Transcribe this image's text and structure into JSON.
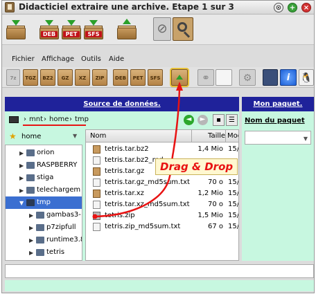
{
  "window": {
    "title": "Didacticiel extraire une archive. Etape 1 sur 3",
    "controls": {
      "minimize": "⊙",
      "maximize": "+",
      "close": "×"
    }
  },
  "toolbar_top": {
    "buttons": [
      {
        "icon": "extract-box-icon",
        "label": ""
      },
      {
        "icon": "deb-package-icon",
        "label": "DEB"
      },
      {
        "icon": "pet-package-icon",
        "label": "PET"
      },
      {
        "icon": "sfs-package-icon",
        "label": "SFS"
      },
      {
        "icon": "install-box-icon",
        "label": ""
      },
      {
        "icon": "paperclip-icon",
        "label": ""
      },
      {
        "icon": "magnifier-icon",
        "label": ""
      }
    ]
  },
  "menu": [
    "Fichier",
    "Affichage",
    "Outils",
    "Aide"
  ],
  "toolbar_formats": [
    "7z",
    "TGZ",
    "BZ2",
    "GZ",
    "XZ",
    "ZIP",
    "DEB",
    "PET",
    "SFS"
  ],
  "panels": {
    "source_title": "Source de données.",
    "package_title": "Mon paquet."
  },
  "path": {
    "crumbs": [
      "mnt",
      "home",
      "tmp"
    ]
  },
  "places": {
    "current": "home"
  },
  "tree": [
    {
      "name": "orion",
      "expanded": false,
      "selected": false
    },
    {
      "name": "RASPBERRY",
      "expanded": false,
      "selected": false
    },
    {
      "name": "stiga",
      "expanded": false,
      "selected": false
    },
    {
      "name": "telechargem",
      "expanded": false,
      "selected": false
    },
    {
      "name": "tmp",
      "expanded": true,
      "selected": true
    },
    {
      "name": "gambas3-",
      "expanded": false,
      "selected": false
    },
    {
      "name": "p7zipfull",
      "expanded": false,
      "selected": false
    },
    {
      "name": "runtime3.8",
      "expanded": false,
      "selected": false
    },
    {
      "name": "tetris",
      "expanded": false,
      "selected": false
    }
  ],
  "files": {
    "columns": {
      "name": "Nom",
      "size": "Taille",
      "modified": "Mod"
    },
    "rows": [
      {
        "name": "tetris.tar.bz2",
        "size": "1,4 Mio",
        "modified": "15/",
        "kind": "archive"
      },
      {
        "name": "tetris.tar.bz2_md",
        "size": "",
        "modified": "",
        "kind": "text"
      },
      {
        "name": "tetris.tar.gz",
        "size": "",
        "modified": "",
        "kind": "archive"
      },
      {
        "name": "tetris.tar.gz_md5sum.txt",
        "size": "70 o",
        "modified": "15/",
        "kind": "text"
      },
      {
        "name": "tetris.tar.xz",
        "size": "1,2 Mio",
        "modified": "15/",
        "kind": "archive"
      },
      {
        "name": "tetris.tar.xz_md5sum.txt",
        "size": "70 o",
        "modified": "15/",
        "kind": "text"
      },
      {
        "name": "tetris.zip",
        "size": "1,5 Mio",
        "modified": "15/",
        "kind": "zip"
      },
      {
        "name": "tetris.zip_md5sum.txt",
        "size": "67 o",
        "modified": "15/",
        "kind": "text"
      }
    ]
  },
  "package": {
    "name_label": "Nom du paquet",
    "name_value": ""
  },
  "annotation": {
    "text": "Drag & Drop",
    "color": "#e81313"
  }
}
